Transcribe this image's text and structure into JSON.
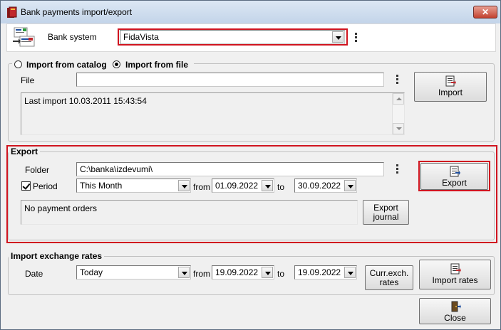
{
  "window": {
    "title": "Bank payments import/export",
    "close_glyph": "✕"
  },
  "bank": {
    "label": "Bank system",
    "value": "FidaVista"
  },
  "import": {
    "radio_catalog": "Import from catalog",
    "radio_file": "Import from file",
    "selected": "file",
    "file_label": "File",
    "file_value": "",
    "log": "Last import 10.03.2011 15:43:54",
    "button": "Import"
  },
  "export": {
    "title": "Export",
    "folder_label": "Folder",
    "folder_value": "C:\\banka\\izdevumi\\",
    "period_label": "Period",
    "period_checked": true,
    "period_value": "This Month",
    "from_label": "from",
    "from_value": "01.09.2022",
    "to_label": "to",
    "to_value": "30.09.2022",
    "log": "No payment orders",
    "journal_button": [
      "Export",
      "journal"
    ],
    "button": "Export"
  },
  "rates": {
    "title": "Import exchange rates",
    "date_label": "Date",
    "date_value": "Today",
    "from_label": "from",
    "from_value": "19.09.2022",
    "to_label": "to",
    "to_value": "19.09.2022",
    "curr_button": [
      "Curr.exch.",
      "rates"
    ],
    "button": "Import rates"
  },
  "close_button": "Close",
  "colors": {
    "highlight": "#d0141f",
    "title_bar": "#c3d4e9"
  }
}
